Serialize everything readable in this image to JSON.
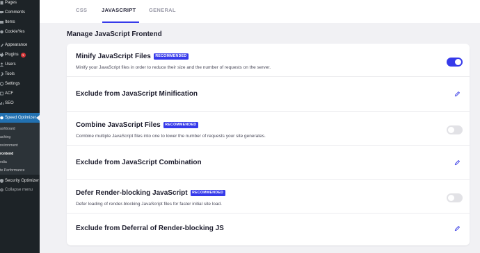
{
  "sidebar": {
    "items": [
      {
        "label": "Pages",
        "icon": "pages-icon"
      },
      {
        "label": "Comments",
        "icon": "comments-icon"
      },
      {
        "label": "Items",
        "icon": "items-icon"
      },
      {
        "label": "CookieYes",
        "icon": "cookieyes-icon"
      },
      {
        "label": "Appearance",
        "icon": "appearance-icon"
      },
      {
        "label": "Plugins",
        "icon": "plugins-icon",
        "badge": "1"
      },
      {
        "label": "Users",
        "icon": "users-icon"
      },
      {
        "label": "Tools",
        "icon": "tools-icon"
      },
      {
        "label": "Settings",
        "icon": "settings-icon"
      },
      {
        "label": "ACF",
        "icon": "acf-icon"
      },
      {
        "label": "SEO",
        "icon": "seo-icon"
      },
      {
        "label": "Speed Optimizer",
        "icon": "speed-optimizer-icon"
      }
    ],
    "submenu": [
      "ashboard",
      "aching",
      "nvironment",
      "rontend",
      "edia",
      "te Performance"
    ],
    "security_label": "Security Optimizer",
    "collapse_label": "Collapse menu"
  },
  "tabs": [
    {
      "label": "CSS"
    },
    {
      "label": "JAVASCRIPT"
    },
    {
      "label": "GENERAL"
    }
  ],
  "section_title": "Manage JavaScript Frontend",
  "recommended_label": "RECOMMENDED",
  "rows": [
    {
      "title": "Minify JavaScript Files",
      "description": "Minify your JavaScript files in order to reduce their size and the number of requests on the server.",
      "control": "toggle",
      "enabled": true
    },
    {
      "title": "Exclude from JavaScript Minification",
      "control": "edit"
    },
    {
      "title": "Combine JavaScript Files",
      "description": "Combine multiple JavaScript files into one to lower the number of requests your site generates.",
      "control": "toggle",
      "enabled": false
    },
    {
      "title": "Exclude from JavaScript Combination",
      "control": "edit"
    },
    {
      "title": "Defer Render-blocking JavaScript",
      "description": "Defer loading of render-blocking JavaScript files for faster initial site load.",
      "control": "toggle",
      "enabled": false
    },
    {
      "title": "Exclude from Deferral of Render-blocking JS",
      "control": "edit"
    }
  ],
  "colors": {
    "accent": "#363aea",
    "sidebar": "#1d2327",
    "wp_active": "#2271b1",
    "badge_red": "#d63638"
  }
}
